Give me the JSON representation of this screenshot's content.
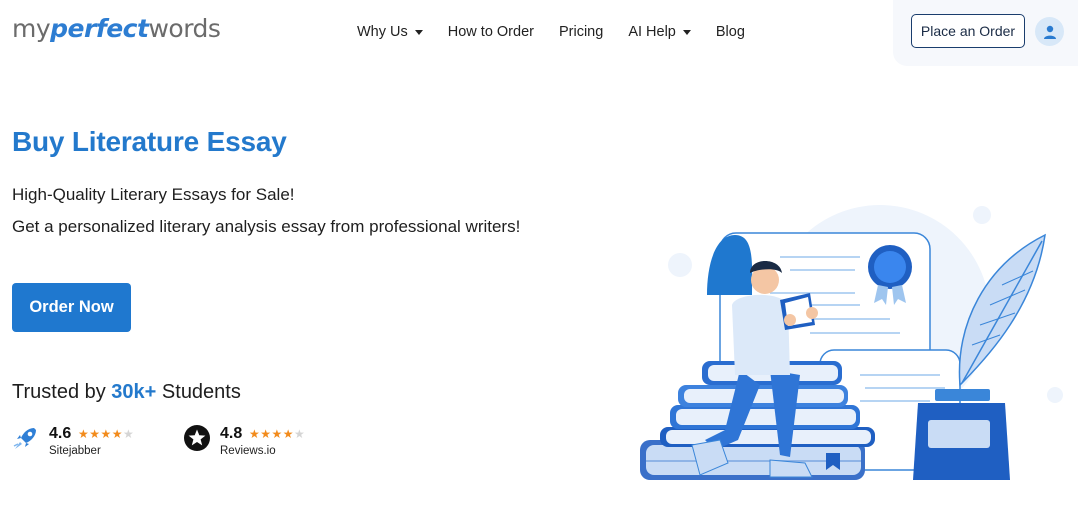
{
  "header": {
    "logo": {
      "part1": "my",
      "part2": "perfect",
      "part3": "words"
    },
    "nav": [
      {
        "label": "Why Us",
        "has_dropdown": true
      },
      {
        "label": "How to Order",
        "has_dropdown": false
      },
      {
        "label": "Pricing",
        "has_dropdown": false
      },
      {
        "label": "AI Help",
        "has_dropdown": true
      },
      {
        "label": "Blog",
        "has_dropdown": false
      }
    ],
    "place_order_label": "Place an Order",
    "avatar_icon": "user-icon"
  },
  "hero": {
    "title": "Buy Literature Essay",
    "subtitle1": "High-Quality Literary Essays for Sale!",
    "subtitle2": "Get a personalized literary analysis essay from professional writers!",
    "cta_label": "Order Now",
    "trusted_prefix": "Trusted by ",
    "trusted_highlight": "30k+",
    "trusted_suffix": " Students",
    "ratings": [
      {
        "score": "4.6",
        "source": "Sitejabber",
        "stars": 4,
        "icon": "rocket-icon"
      },
      {
        "score": "4.8",
        "source": "Reviews.io",
        "stars": 4,
        "icon": "star-badge-icon"
      }
    ]
  },
  "colors": {
    "brand_blue": "#2379cc",
    "button_blue": "#1f78cf",
    "star_orange": "#f28b1c"
  }
}
